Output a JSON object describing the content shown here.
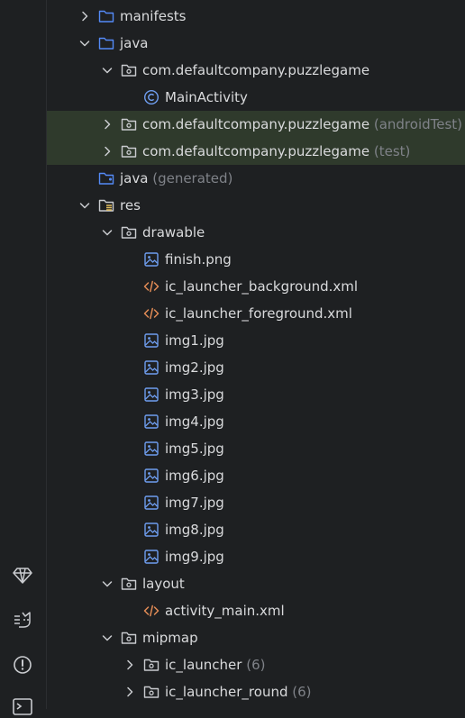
{
  "colors": {
    "background": "#1e2022",
    "highlight_row": "#2f3a2c",
    "text": "#d9dadc",
    "dim_text": "#7f8288",
    "folder_blue": "#548af7",
    "folder_gray": "#c9cbcf",
    "xml_orange": "#e38c56",
    "image_blue": "#6f9ef0"
  },
  "sidebar_icons": [
    "gem-icon",
    "cat-icon",
    "warning-circle-icon",
    "terminal-icon"
  ],
  "tree": [
    {
      "depth": 0,
      "arrow": "right",
      "icon": "folder",
      "label": "manifests"
    },
    {
      "depth": 0,
      "arrow": "down",
      "icon": "folder",
      "label": "java"
    },
    {
      "depth": 1,
      "arrow": "down",
      "icon": "package",
      "label": "com.defaultcompany.puzzlegame"
    },
    {
      "depth": 2,
      "arrow": "",
      "icon": "class",
      "label": "MainActivity"
    },
    {
      "depth": 1,
      "arrow": "right",
      "icon": "package",
      "label": "com.defaultcompany.puzzlegame",
      "suffix": "(androidTest)",
      "highlight": true
    },
    {
      "depth": 1,
      "arrow": "right",
      "icon": "package",
      "label": "com.defaultcompany.puzzlegame",
      "suffix": "(test)",
      "highlight": true
    },
    {
      "depth": 0,
      "arrow": "",
      "icon": "generated-folder",
      "label": "java",
      "suffix": "(generated)"
    },
    {
      "depth": 0,
      "arrow": "down",
      "icon": "res-folder",
      "label": "res"
    },
    {
      "depth": 1,
      "arrow": "down",
      "icon": "package",
      "label": "drawable"
    },
    {
      "depth": 2,
      "arrow": "",
      "icon": "image",
      "label": "finish.png"
    },
    {
      "depth": 2,
      "arrow": "",
      "icon": "xml",
      "label": "ic_launcher_background.xml"
    },
    {
      "depth": 2,
      "arrow": "",
      "icon": "xml",
      "label": "ic_launcher_foreground.xml"
    },
    {
      "depth": 2,
      "arrow": "",
      "icon": "image",
      "label": "img1.jpg"
    },
    {
      "depth": 2,
      "arrow": "",
      "icon": "image",
      "label": "img2.jpg"
    },
    {
      "depth": 2,
      "arrow": "",
      "icon": "image",
      "label": "img3.jpg"
    },
    {
      "depth": 2,
      "arrow": "",
      "icon": "image",
      "label": "img4.jpg"
    },
    {
      "depth": 2,
      "arrow": "",
      "icon": "image",
      "label": "img5.jpg"
    },
    {
      "depth": 2,
      "arrow": "",
      "icon": "image",
      "label": "img6.jpg"
    },
    {
      "depth": 2,
      "arrow": "",
      "icon": "image",
      "label": "img7.jpg"
    },
    {
      "depth": 2,
      "arrow": "",
      "icon": "image",
      "label": "img8.jpg"
    },
    {
      "depth": 2,
      "arrow": "",
      "icon": "image",
      "label": "img9.jpg"
    },
    {
      "depth": 1,
      "arrow": "down",
      "icon": "package",
      "label": "layout"
    },
    {
      "depth": 2,
      "arrow": "",
      "icon": "xml",
      "label": "activity_main.xml"
    },
    {
      "depth": 1,
      "arrow": "down",
      "icon": "package",
      "label": "mipmap"
    },
    {
      "depth": 2,
      "arrow": "right",
      "icon": "package",
      "label": "ic_launcher",
      "suffix": "(6)"
    },
    {
      "depth": 2,
      "arrow": "right",
      "icon": "package",
      "label": "ic_launcher_round",
      "suffix": "(6)"
    }
  ]
}
